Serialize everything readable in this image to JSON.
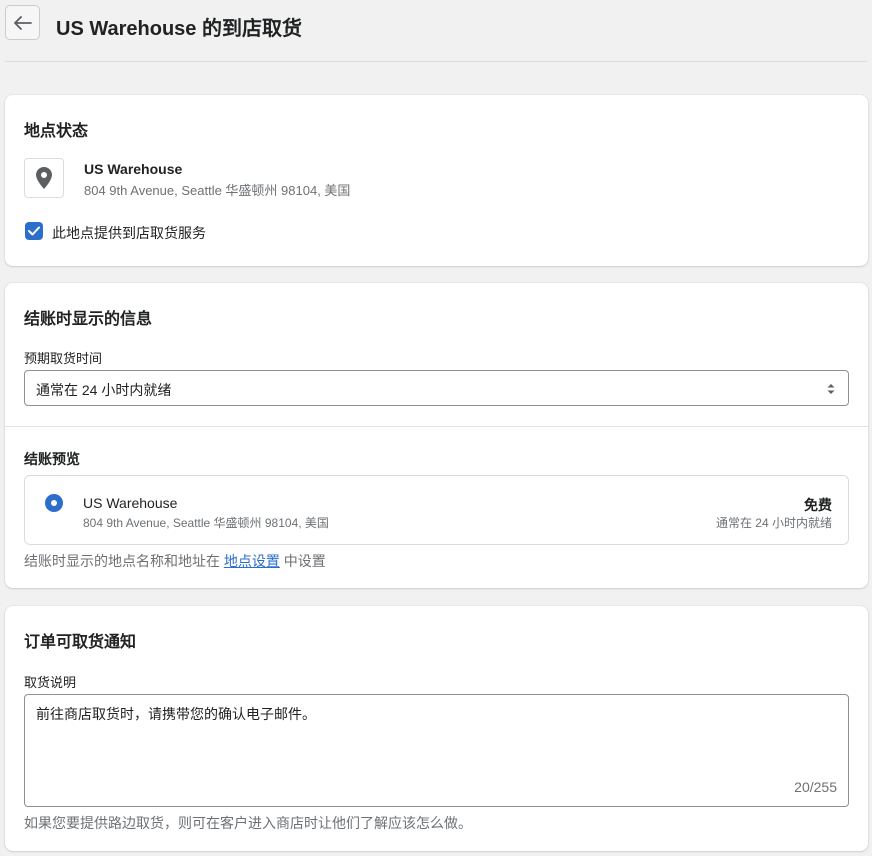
{
  "header": {
    "title": "US Warehouse 的到店取货"
  },
  "location_status": {
    "title": "地点状态",
    "location_name": "US Warehouse",
    "location_address": "804 9th Avenue, Seattle 华盛顿州 98104, 美国",
    "checkbox_label": "此地点提供到店取货服务",
    "checkbox_checked": true
  },
  "checkout_info": {
    "title": "结账时显示的信息",
    "pickup_time_label": "预期取货时间",
    "pickup_time_value": "通常在 24 小时内就绪",
    "preview_heading": "结账预览",
    "preview": {
      "name": "US Warehouse",
      "address": "804 9th Avenue, Seattle 华盛顿州 98104, 美国",
      "price": "免费",
      "time": "通常在 24 小时内就绪"
    },
    "help_prefix": "结账时显示的地点名称和地址在",
    "help_link": "地点设置",
    "help_suffix": "中设置"
  },
  "notification": {
    "title": "订单可取货通知",
    "instructions_label": "取货说明",
    "instructions_value": "前往商店取货时，请携带您的确认电子邮件。",
    "char_count": "20/255",
    "help_text": "如果您要提供路边取货，则可在客户进入商店时让他们了解应该怎么做。"
  },
  "colors": {
    "accent": "#2c6ecb",
    "background": "#f1f1f1"
  },
  "icons": {
    "back": "arrow-left-icon",
    "location": "location-pin-icon",
    "checkbox": "checkmark-icon",
    "select": "select-arrows-icon"
  }
}
